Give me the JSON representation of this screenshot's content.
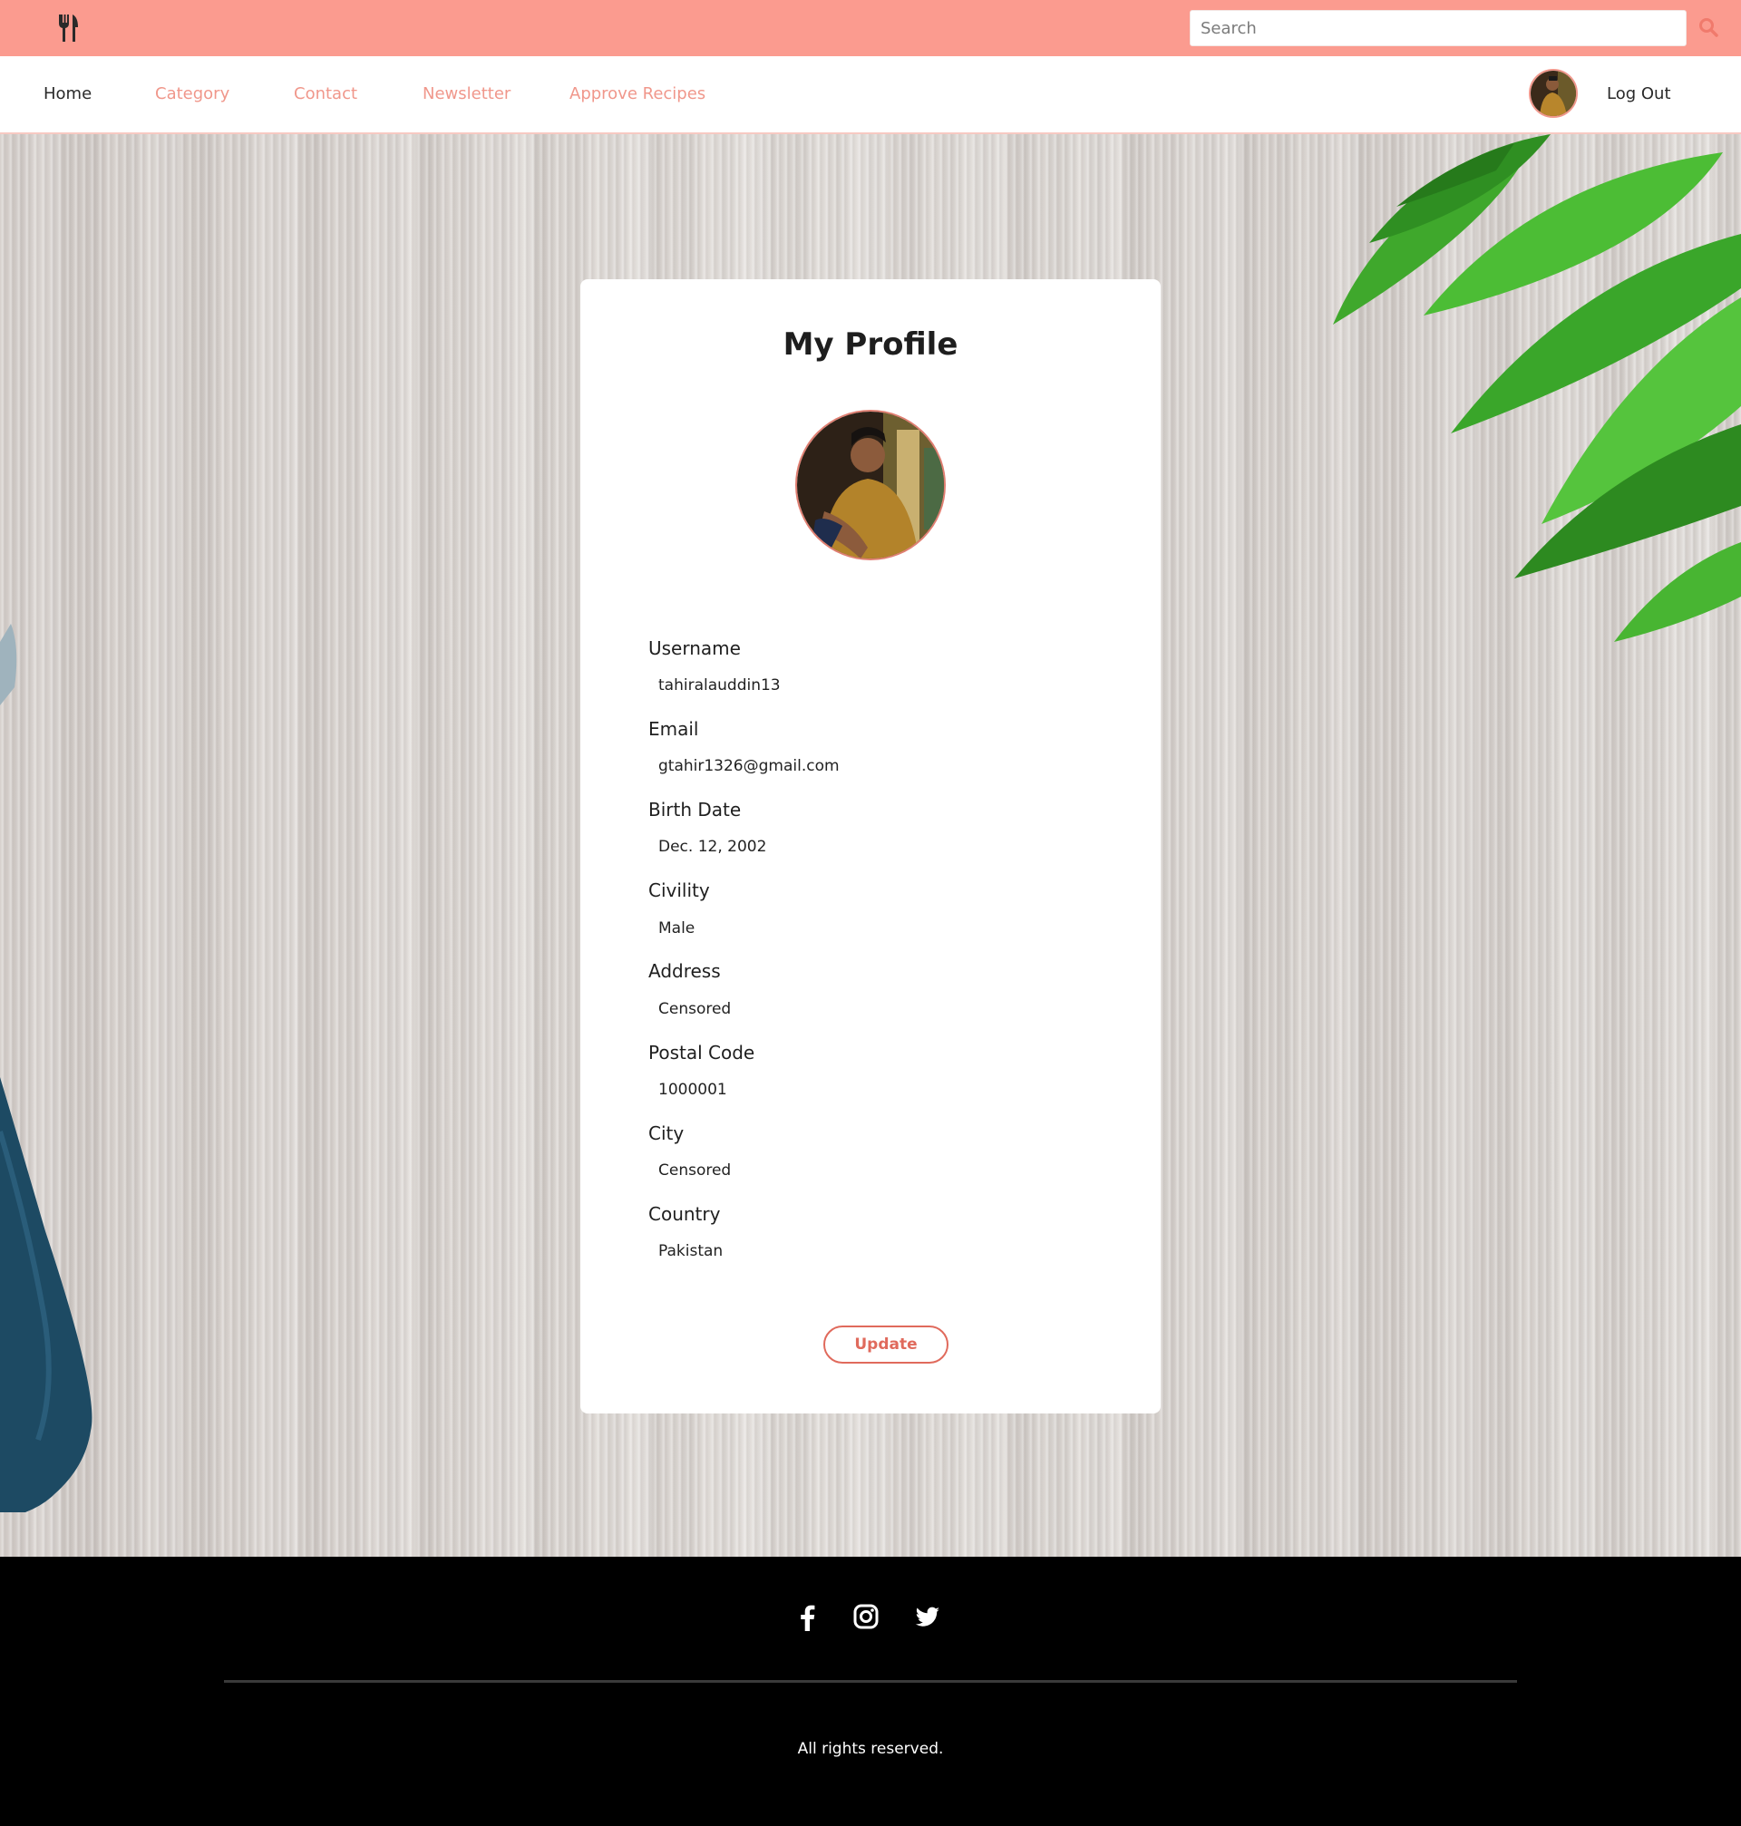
{
  "topbar": {
    "logo_icon": "fork-knife-icon",
    "search_placeholder": "Search",
    "search_icon": "search-icon",
    "accent_color": "#fb9b8f"
  },
  "nav": {
    "links": [
      "Home",
      "Category",
      "Contact",
      "Newsletter",
      "Approve Recipes"
    ],
    "logout_label": "Log Out",
    "link_color": "#f0978b"
  },
  "profile": {
    "title": "My Profile",
    "fields": [
      {
        "label": "Username",
        "value": "tahiralauddin13"
      },
      {
        "label": "Email",
        "value": "gtahir1326@gmail.com"
      },
      {
        "label": "Birth Date",
        "value": "Dec. 12, 2002"
      },
      {
        "label": "Civility",
        "value": "Male"
      },
      {
        "label": "Address",
        "value": "Censored"
      },
      {
        "label": "Postal Code",
        "value": "1000001"
      },
      {
        "label": "City",
        "value": "Censored"
      },
      {
        "label": "Country",
        "value": "Pakistan"
      }
    ],
    "update_label": "Update"
  },
  "footer": {
    "social_icons": [
      "facebook-icon",
      "instagram-icon",
      "twitter-icon"
    ],
    "copyright": "All rights reserved."
  }
}
